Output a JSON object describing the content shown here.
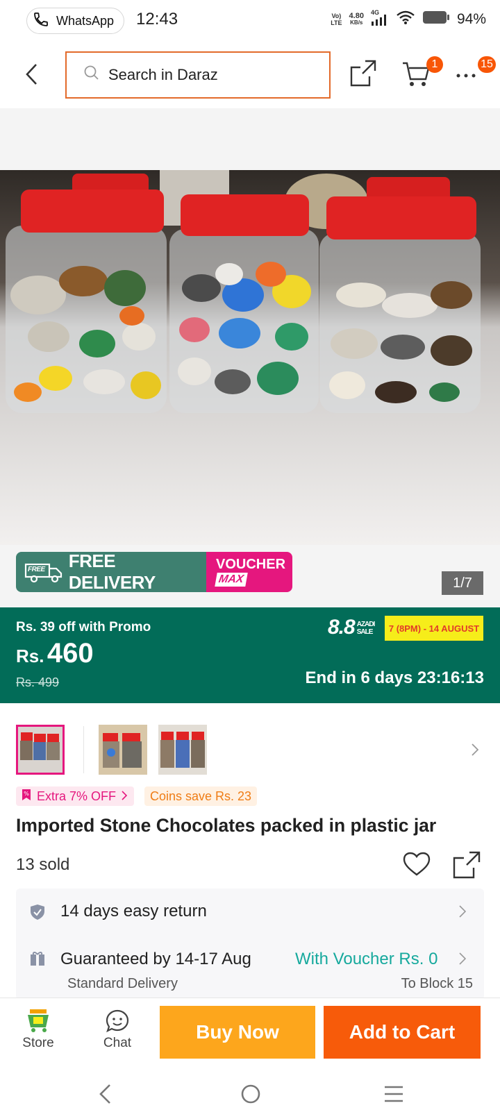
{
  "status_bar": {
    "app_pill": "WhatsApp",
    "time": "12:43",
    "volte_top": "Vo)",
    "volte_bottom": "LTE",
    "speed_value": "4.80",
    "speed_unit": "KB/s",
    "network": "4G",
    "battery": "94%"
  },
  "header": {
    "search_placeholder": "Search in Daraz",
    "cart_badge": "1",
    "more_badge": "15"
  },
  "gallery": {
    "counter": "1/7",
    "free_delivery_badge": "FREE",
    "free_delivery_text": "FREE DELIVERY",
    "voucher_line1": "VOUCHER",
    "voucher_line2": "MAX"
  },
  "price": {
    "promo_text": "Rs. 39 off with Promo",
    "currency": "Rs.",
    "amount": "460",
    "original": "Rs. 499",
    "sale_logo": "8.8",
    "sale_logo_small_1": "AZADI",
    "sale_logo_small_2": "SALE",
    "sale_dates": "7 (8PM) - 14 AUGUST",
    "countdown": "End in 6 days 23:16:13"
  },
  "tags": {
    "extra_off": "Extra 7% OFF",
    "coins": "Coins save Rs. 23"
  },
  "product": {
    "title": "Imported Stone Chocolates packed in plastic jar",
    "sold": "13 sold"
  },
  "services": {
    "return_text": "14 days easy return",
    "delivery_text": "Guaranteed by 14-17 Aug",
    "voucher_text": "With Voucher Rs. 0",
    "delivery_type": "Standard Delivery",
    "location": "To Block 15"
  },
  "bottom_bar": {
    "store_label": "Store",
    "chat_label": "Chat",
    "buy_now": "Buy Now",
    "add_to_cart": "Add to Cart"
  },
  "colors": {
    "accent_orange": "#f85606",
    "price_green": "#026c58",
    "voucher_pink": "#e5177e",
    "buy_now": "#fda61c",
    "add_to_cart": "#f75b0a"
  }
}
